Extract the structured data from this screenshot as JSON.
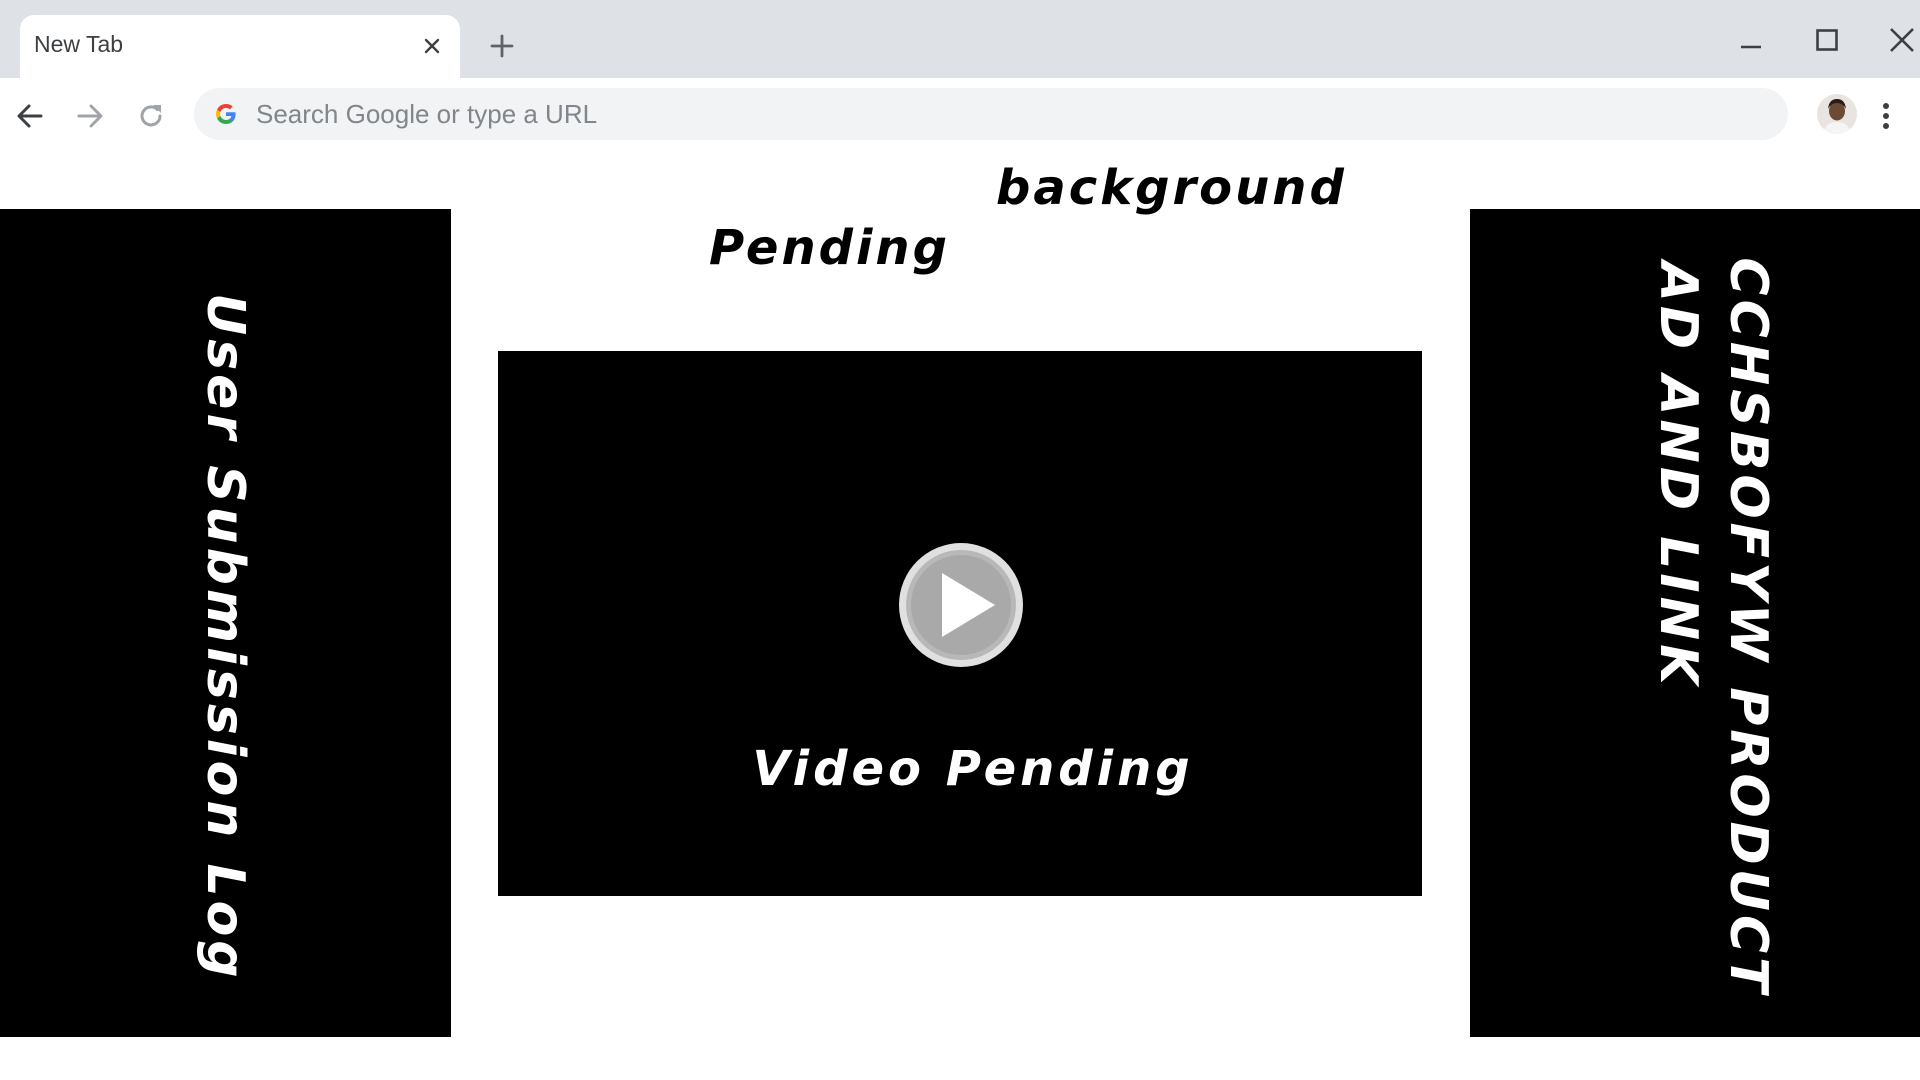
{
  "browser": {
    "tab": {
      "title": "New Tab"
    },
    "omnibox": {
      "placeholder": "Search Google or type a URL"
    }
  },
  "page": {
    "headings": {
      "background": "background",
      "pending": "Pending"
    },
    "left_panel": {
      "label": "User Submission Log"
    },
    "right_panel": {
      "line1": "CCHSBOFYW PRODUCT",
      "line2": "AD AND LINK"
    },
    "video": {
      "caption": "Video Pending"
    }
  },
  "colors": {
    "tabstrip": "#dee1e6",
    "omnibox": "#f1f3f4",
    "panel": "#000000",
    "play_button": "#c8c8c8"
  },
  "icons": {
    "tab_close": "close-icon",
    "new_tab": "plus-icon",
    "minimize": "minimize-icon",
    "maximize": "maximize-icon",
    "close_window": "close-icon",
    "back": "arrow-left-icon",
    "forward": "arrow-right-icon",
    "reload": "reload-icon",
    "search_engine": "google-g-icon",
    "profile": "avatar",
    "menu": "kebab-menu-icon",
    "play": "play-icon"
  }
}
